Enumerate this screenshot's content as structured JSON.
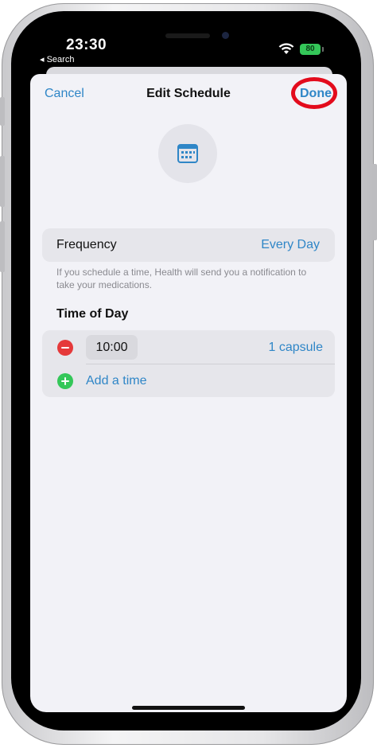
{
  "status_bar": {
    "time": "23:30",
    "back_label": "◂ Search",
    "battery": "80"
  },
  "nav": {
    "cancel_label": "Cancel",
    "title": "Edit Schedule",
    "done_label": "Done"
  },
  "header_icon": "calendar-icon",
  "frequency": {
    "label": "Frequency",
    "value": "Every Day",
    "footnote": "If you schedule a time, Health will send you a notification to take your medications."
  },
  "time_of_day": {
    "title": "Time of Day",
    "entries": [
      {
        "time": "10:00",
        "dose": "1 capsule"
      }
    ],
    "add_label": "Add a time"
  },
  "colors": {
    "accent": "#2f86c7",
    "annotation_ring": "#e30b1c",
    "remove": "#e5393a",
    "add": "#34c759",
    "battery": "#34c759"
  }
}
